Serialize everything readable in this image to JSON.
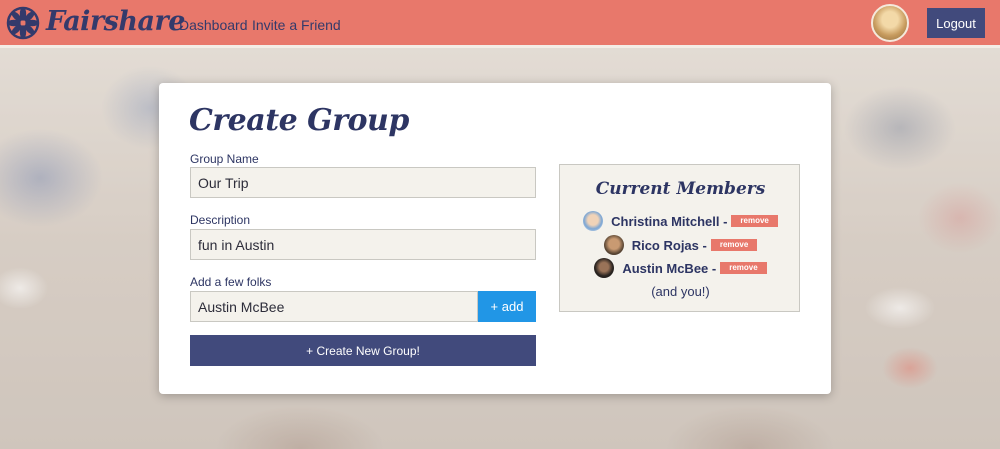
{
  "navbar": {
    "brand": "Fairshare",
    "links": [
      "Dashboard",
      "Invite a Friend"
    ],
    "logout_label": "Logout",
    "bg_color": "#e8786b"
  },
  "form": {
    "title": "Create Group",
    "group_name_label": "Group Name",
    "group_name_value": "Our Trip",
    "description_label": "Description",
    "description_value": "fun in Austin",
    "folks_label": "Add a few folks",
    "folks_value": "Austin McBee",
    "add_label": "+ add",
    "create_label": "+ Create New Group!"
  },
  "members": {
    "title": "Current Members",
    "list": [
      {
        "name": "Christina Mitchell -",
        "remove_label": "remove"
      },
      {
        "name": "Rico Rojas -",
        "remove_label": "remove"
      },
      {
        "name": "Austin McBee -",
        "remove_label": "remove"
      }
    ],
    "footer": "(and you!)"
  },
  "colors": {
    "navy": "#2d3563",
    "button_navy": "#414a7c",
    "add_blue": "#2196e6",
    "coral": "#e8786b"
  },
  "icons": {
    "logo": "fairshare-flower-logo-icon"
  }
}
